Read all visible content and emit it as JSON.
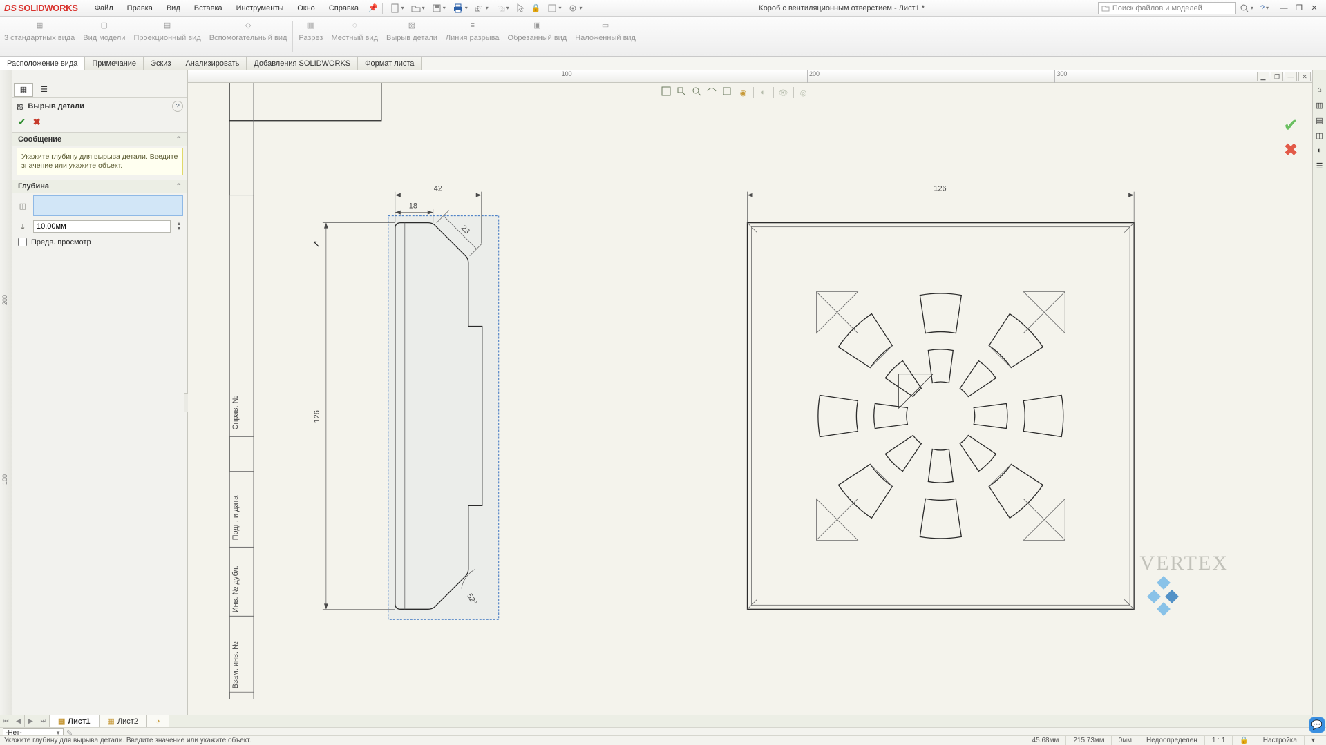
{
  "menu": {
    "items": [
      "Файл",
      "Правка",
      "Вид",
      "Вставка",
      "Инструменты",
      "Окно",
      "Справка"
    ],
    "logo_brand": "SOLIDWORKS",
    "logo_prefix": "DS"
  },
  "doc_title": "Короб с вентиляционным отверстием - Лист1 *",
  "search_placeholder": "Поиск файлов и моделей",
  "ribbon": {
    "buttons": [
      "3 стандартных вида",
      "Вид модели",
      "Проекционный вид",
      "Вспомогательный вид",
      "Разрез",
      "Местный вид",
      "Вырыв детали",
      "Линия разрыва",
      "Обрезанный вид",
      "Наложенный вид"
    ]
  },
  "cmd_tabs": [
    "Расположение вида",
    "Примечание",
    "Эскиз",
    "Анализировать",
    "Добавления SOLIDWORKS",
    "Формат листа"
  ],
  "property": {
    "title": "Вырыв детали",
    "section_msg": "Сообщение",
    "msg": "Укажите глубину для вырыва детали. Введите значение или укажите объект.",
    "section_depth": "Глубина",
    "depth_value": "10.00мм",
    "preview_label": "Предв. просмотр"
  },
  "ruler": {
    "marks": [
      "100",
      "200",
      "300"
    ]
  },
  "left_ruler": {
    "marks": [
      "100",
      "200"
    ]
  },
  "sheet_tabs": {
    "tabs": [
      "Лист1",
      "Лист2"
    ],
    "active": 0
  },
  "layer_bar": {
    "value": "-Нет-"
  },
  "status": {
    "hint": "Укажите глубину для вырыва детали. Введите значение или укажите объект.",
    "x": "45.68мм",
    "y": "215.73мм",
    "z": "0мм",
    "state": "Недоопределен",
    "scale": "1 : 1",
    "custom": "Настройка"
  },
  "dims": {
    "top42": "42",
    "top18": "18",
    "left126": "126",
    "right126": "126",
    "ang23": "23",
    "ang52": "52°"
  },
  "titleblock": {
    "rows": [
      "Справ. №",
      "Подп. и дата",
      "Инв. № дубл.",
      "Взам. инв. №"
    ]
  },
  "watermark": "VERTEX"
}
